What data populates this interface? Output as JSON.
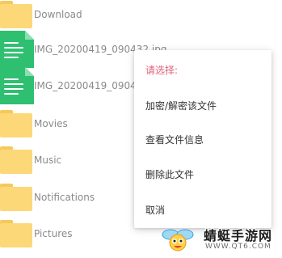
{
  "files": [
    {
      "name": "Download",
      "type": "folder"
    },
    {
      "name": "IMG_20200419_090432.jpg",
      "type": "document"
    },
    {
      "name": "IMG_20200419_09043",
      "type": "document"
    },
    {
      "name": "Movies",
      "type": "folder"
    },
    {
      "name": "Music",
      "type": "folder"
    },
    {
      "name": "Notifications",
      "type": "folder"
    },
    {
      "name": "Pictures",
      "type": "folder"
    }
  ],
  "context_menu": {
    "title": "请选择:",
    "items": [
      "加密/解密该文件",
      "查看文件信息",
      "删除此文件",
      "取消"
    ]
  },
  "watermark": {
    "title": "蜻蜓手游网",
    "url": "WWW.QT6.COM"
  },
  "colors": {
    "menu_title": "#e0607b",
    "folder": "#fcd878",
    "document": "#2fbf71"
  }
}
